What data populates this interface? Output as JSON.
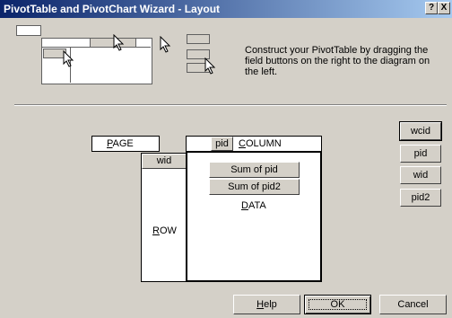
{
  "window": {
    "title": "PivotTable and PivotChart Wizard - Layout",
    "help_glyph": "?",
    "close_glyph": "X"
  },
  "instructions": "Construct your PivotTable by dragging the field buttons on the right to the diagram on the left.",
  "layout": {
    "page_label_rest": "AGE",
    "page_label_u": "P",
    "column_field": "pid",
    "column_label_u": "C",
    "column_label_rest": "OLUMN",
    "row_field": "wid",
    "row_label_u": "R",
    "row_label_rest": "OW",
    "data_fields": [
      "Sum of pid",
      "Sum of pid2"
    ],
    "data_label_u": "D",
    "data_label_rest": "ATA"
  },
  "field_buttons": [
    "wcid",
    "pid",
    "wid",
    "pid2"
  ],
  "buttons": {
    "help_u": "H",
    "help_rest": "elp",
    "ok": "OK",
    "cancel": "Cancel"
  }
}
